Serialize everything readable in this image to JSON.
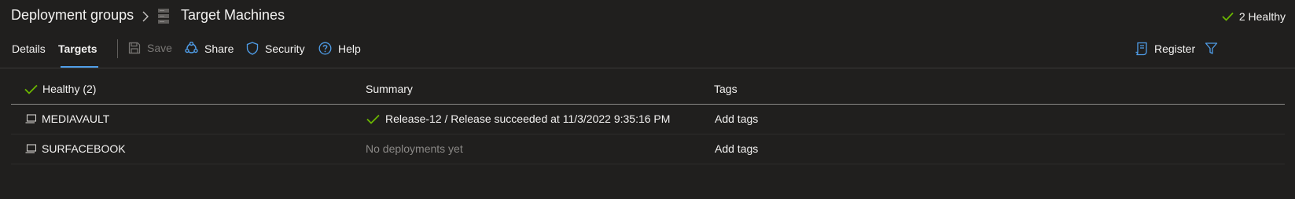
{
  "breadcrumb": {
    "root": "Deployment groups",
    "current": "Target Machines"
  },
  "health_summary": {
    "count_text": "2 Healthy",
    "color": "#6bb700"
  },
  "tabs": [
    {
      "label": "Details",
      "selected": false
    },
    {
      "label": "Targets",
      "selected": true
    }
  ],
  "commands": {
    "save": "Save",
    "share": "Share",
    "security": "Security",
    "help": "Help",
    "register": "Register"
  },
  "table": {
    "columns": {
      "status": "Healthy (2)",
      "summary": "Summary",
      "tags": "Tags"
    },
    "rows": [
      {
        "machine": "MEDIAVAULT",
        "summary": "Release-12 / Release succeeded at 11/3/2022 9:35:16 PM",
        "tags": "Add tags"
      },
      {
        "machine": "SURFACEBOOK",
        "summary": "No deployments yet",
        "tags": "Add tags"
      }
    ]
  },
  "colors": {
    "accent": "#4f9de8",
    "success": "#6bb700",
    "background": "#201f1e"
  }
}
